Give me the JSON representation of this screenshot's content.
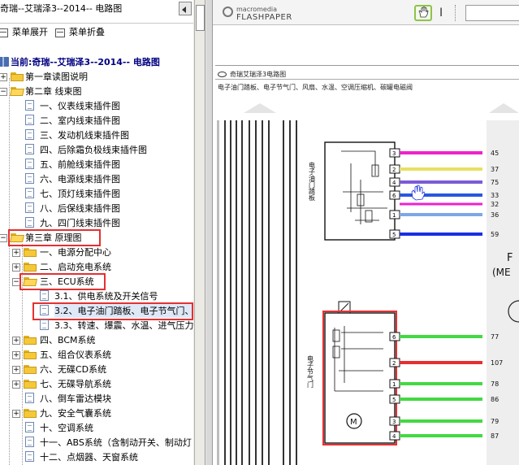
{
  "left_pane": {
    "title": "奇瑞--艾瑞泽3--2014-- 电路图",
    "toolbar": {
      "expand_label": "菜单展开",
      "collapse_label": "菜单折叠"
    },
    "tree": {
      "current_label": "当前:奇瑞--艾瑞泽3--2014-- 电路图",
      "chapters": [
        {
          "label": "第一章读图说明",
          "toggle": "+"
        },
        {
          "label": "第二章 线束图",
          "toggle": "−"
        }
      ],
      "chapter2_items": [
        "一、仪表线束插件图",
        "二、室内线束插件图",
        "三、发动机线束插件图",
        "四、后除霜负极线束插件图",
        "五、前舱线束插件图",
        "六、电源线束插件图",
        "七、顶灯线束插件图",
        "八、后保线束插件图",
        "九、四门线束插件图"
      ],
      "chapter3": {
        "label": "第三章 原理图",
        "toggle": "−"
      },
      "chapter3_items": [
        {
          "label": "一、电源分配中心",
          "toggle": "+"
        },
        {
          "label": "二、启动充电系统",
          "toggle": "+"
        },
        {
          "label": "三、ECU系统",
          "toggle": "−"
        }
      ],
      "ecu_items": [
        "3.1、供电系统及开关信号",
        "3.2、电子油门踏板、电子节气门、",
        "3.3、转速、爆震、水温、进气压力"
      ],
      "chapter3_rest": [
        "四、BCM系统",
        "五、组合仪表系统",
        "六、无碟CD系统",
        "七、无碟导航系统",
        "八、倒车雷达模块",
        "九、安全气囊系统",
        "十、空调系统",
        "十一、ABS系统（含制动开关、制动灯",
        "十二、点烟器、天窗系统"
      ]
    }
  },
  "viewer": {
    "logo_small": "macromedia",
    "logo_big": "FLASHPAPER",
    "hand_tool_icon": "hand-icon",
    "text_tool_glyph": "I",
    "page_title": "奇瑞艾瑞泽3电路图",
    "page_subtitle": "电子油门踏板、电子节气门、风扇、水温、空调压缩机、碳罐电磁阀",
    "accent_color": "#e53030",
    "diagram": {
      "pedal_label": "电子油门踏板",
      "throttle_label": "电子节气门",
      "ecu_label_1": "(ME",
      "ecu_label_2": "F",
      "pedal_pins": [
        "3",
        "2",
        "4",
        "6",
        "1",
        "5"
      ],
      "pedal_ecu_pins": [
        "45",
        "37",
        "75",
        "33",
        "32",
        "36",
        "59"
      ],
      "throttle_pins": [
        "6",
        "2",
        "1",
        "5",
        "3",
        "4"
      ],
      "throttle_ecu_pins": [
        "77",
        "107",
        "78",
        "86",
        "79",
        "87"
      ],
      "wire_colors": [
        "#ee22cc",
        "#e8e060",
        "#7b5bd6",
        "#2a57e0",
        "#ee22cc",
        "#7fa6e6",
        "#1a2fe0",
        "#43d943",
        "#e33030",
        "#43d943",
        "#43d943",
        "#43d943",
        "#43d943"
      ]
    }
  }
}
